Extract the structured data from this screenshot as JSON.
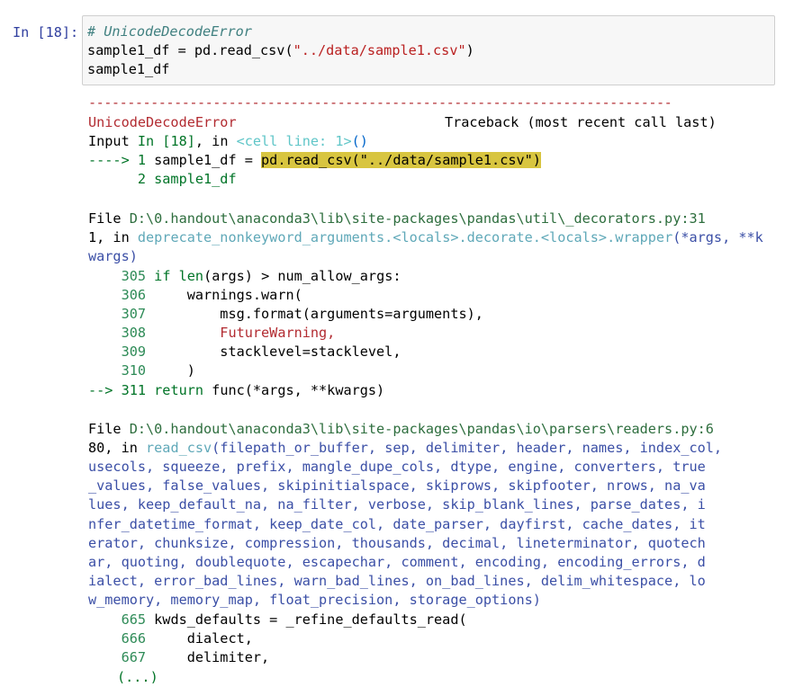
{
  "cell": {
    "prompt": "In [18]:",
    "code_comment": "# UnicodeDecodeError",
    "code_line2_pre": "sample1_df = pd.read_csv(",
    "code_line2_str": "\"../data/sample1.csv\"",
    "code_line2_post": ")",
    "code_line3": "sample1_df"
  },
  "traceback": {
    "separator": "---------------------------------------------------------------------------",
    "error_name": "UnicodeDecodeError",
    "header_right": "Traceback (most recent call last)",
    "input_prefix": "Input ",
    "input_in": "In [18]",
    "input_mid": ", in ",
    "input_cell": "<cell line: 1>",
    "input_paren": "()",
    "arrow1": "----> 1 ",
    "line1_pre": "sample1_df = ",
    "line1_hl": "pd.read_csv(\"../data/sample1.csv\")",
    "line2": "      2 sample1_df",
    "frame1_file_pre": "File ",
    "frame1_file": "D:\\0.handout\\anaconda3\\lib\\site-packages\\pandas\\util\\_decorators.py:31",
    "frame1_line2_pre": "1, in ",
    "frame1_func": "deprecate_nonkeyword_arguments.<locals>.decorate.<locals>.wrapper",
    "frame1_args": "(*args, **k",
    "frame1_line3": "wargs)",
    "frame1_code": [
      {
        "no": "305",
        "code": " if len(args) > num_allow_args:"
      },
      {
        "no": "306",
        "code": "     warnings.warn("
      },
      {
        "no": "307",
        "code": "         msg.format(arguments=arguments),"
      },
      {
        "no": "308",
        "code": "         FutureWarning,"
      },
      {
        "no": "309",
        "code": "         stacklevel=stacklevel,"
      },
      {
        "no": "310",
        "code": "     )"
      }
    ],
    "frame1_arrow": "--> 311 ",
    "frame1_arrow_code_kw": "return",
    "frame1_arrow_code": " func(*args, **kwargs)",
    "frame2_file_pre": "File ",
    "frame2_file": "D:\\0.handout\\anaconda3\\lib\\site-packages\\pandas\\io\\parsers\\readers.py:6",
    "frame2_line2_pre": "80, in ",
    "frame2_func": "read_csv",
    "frame2_sig": [
      "(filepath_or_buffer, sep, delimiter, header, names, index_col,",
      "usecols, squeeze, prefix, mangle_dupe_cols, dtype, engine, converters, true",
      "_values, false_values, skipinitialspace, skiprows, skipfooter, nrows, na_va",
      "lues, keep_default_na, na_filter, verbose, skip_blank_lines, parse_dates, i",
      "nfer_datetime_format, keep_date_col, date_parser, dayfirst, cache_dates, it",
      "erator, chunksize, compression, thousands, decimal, lineterminator, quotech",
      "ar, quoting, doublequote, escapechar, comment, encoding, encoding_errors, d",
      "ialect, error_bad_lines, warn_bad_lines, on_bad_lines, delim_whitespace, lo",
      "w_memory, memory_map, float_precision, storage_options)"
    ],
    "frame2_code": [
      {
        "no": "665",
        "code": " kwds_defaults = _refine_defaults_read("
      },
      {
        "no": "666",
        "code": "     dialect,"
      },
      {
        "no": "667",
        "code": "     delimiter,"
      }
    ],
    "ellipsis": "(...)"
  }
}
